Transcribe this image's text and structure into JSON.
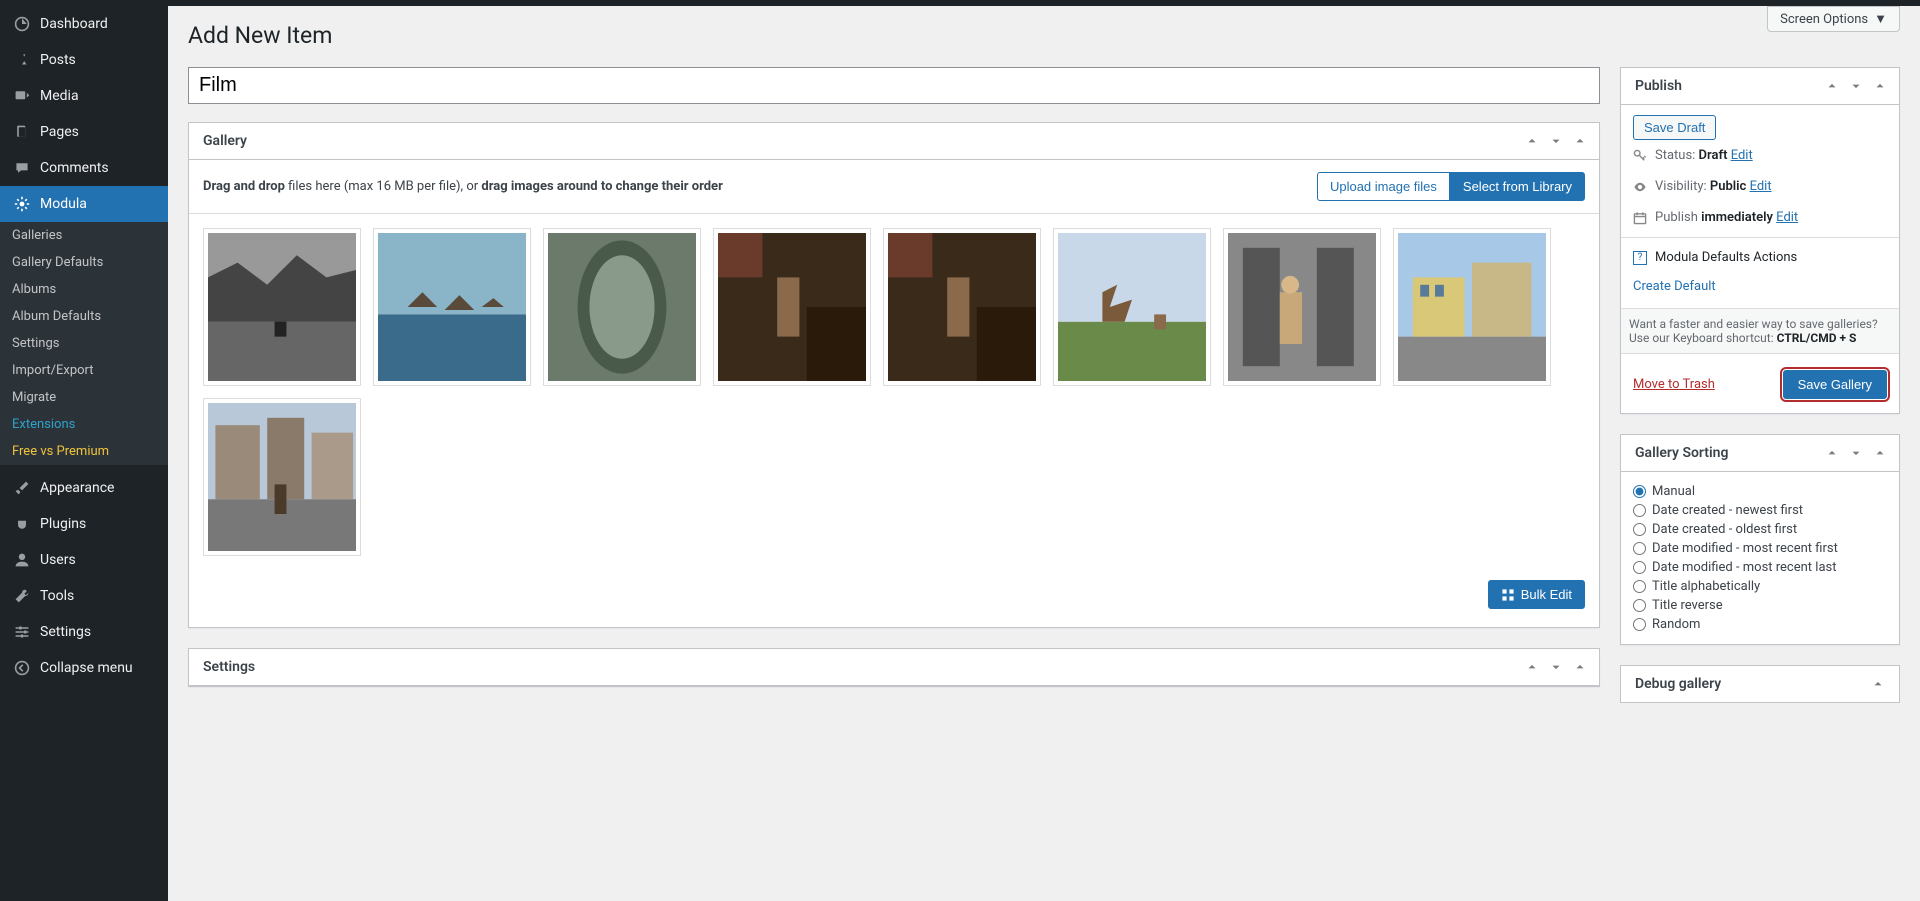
{
  "screen_options": "Screen Options",
  "page_title": "Add New Item",
  "title_value": "Film",
  "sidebar": {
    "dashboard": "Dashboard",
    "posts": "Posts",
    "media": "Media",
    "pages": "Pages",
    "comments": "Comments",
    "modula": "Modula",
    "sub": {
      "galleries": "Galleries",
      "gallery_defaults": "Gallery Defaults",
      "albums": "Albums",
      "album_defaults": "Album Defaults",
      "settings": "Settings",
      "import_export": "Import/Export",
      "migrate": "Migrate",
      "extensions": "Extensions",
      "free_premium": "Free vs Premium"
    },
    "appearance": "Appearance",
    "plugins": "Plugins",
    "users": "Users",
    "tools": "Tools",
    "settings": "Settings",
    "collapse": "Collapse menu"
  },
  "gallery": {
    "title": "Gallery",
    "instruction_1": "Drag and drop",
    "instruction_2": " files here (max 16 MB per file), or ",
    "instruction_3": "drag images around to change their order",
    "upload_btn": "Upload image files",
    "select_btn": "Select from Library",
    "bulk_edit": "Bulk Edit"
  },
  "settings_panel": {
    "title": "Settings"
  },
  "publish": {
    "title": "Publish",
    "save_draft": "Save Draft",
    "status_label": "Status: ",
    "status_value": "Draft",
    "visibility_label": "Visibility: ",
    "visibility_value": "Public",
    "publish_label": "Publish ",
    "publish_value": "immediately",
    "edit": "Edit",
    "defaults_actions": "Modula Defaults Actions",
    "create_default": "Create Default",
    "hint_1": "Want a faster and easier way to save galleries? Use our Keyboard shortcut: ",
    "hint_2": "CTRL/CMD + S",
    "trash": "Move to Trash",
    "save_gallery": "Save Gallery"
  },
  "sorting": {
    "title": "Gallery Sorting",
    "options": [
      "Manual",
      "Date created - newest first",
      "Date created - oldest first",
      "Date modified - most recent first",
      "Date modified - most recent last",
      "Title alphabetically",
      "Title reverse",
      "Random"
    ]
  },
  "debug": {
    "title": "Debug gallery"
  }
}
